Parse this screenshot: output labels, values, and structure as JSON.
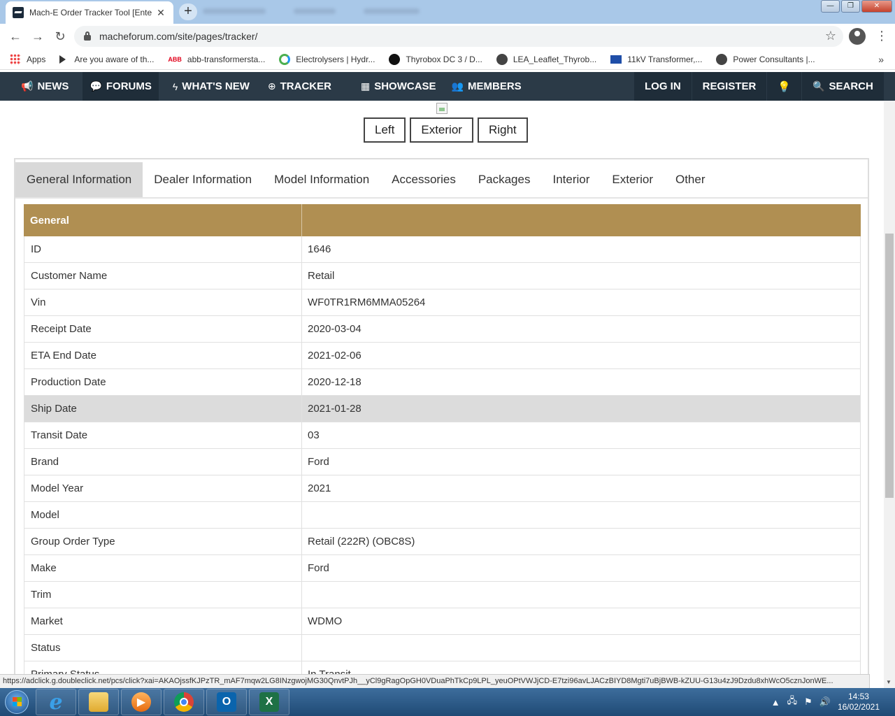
{
  "browser": {
    "tab_title": "Mach-E Order Tracker Tool [Ente",
    "tab_close": "✕",
    "new_tab": "+",
    "back": "←",
    "forward": "→",
    "reload": "↻",
    "url": "macheforum.com/site/pages/tracker/",
    "star": "☆",
    "menu": "⋮",
    "bookmarks_more": "»",
    "window_controls": {
      "minimize": "—",
      "restore": "❐",
      "close": "✕"
    },
    "bookmarks": [
      {
        "label": "Apps",
        "icon": "apps-grid-icon"
      },
      {
        "label": "Are you aware of th...",
        "icon": "play-icon"
      },
      {
        "label": "abb-transformersta...",
        "icon": "abb-logo-icon",
        "logo_text": "ABB"
      },
      {
        "label": "Electrolysers | Hydr...",
        "icon": "electrolysers-icon"
      },
      {
        "label": "Thyrobox DC 3 / D...",
        "icon": "thyrobox-icon"
      },
      {
        "label": "LEA_Leaflet_Thyrob...",
        "icon": "globe-icon"
      },
      {
        "label": "11kV Transformer,...",
        "icon": "sc-logo-icon"
      },
      {
        "label": "Power Consultants |...",
        "icon": "globe-icon"
      }
    ]
  },
  "site_nav": {
    "items": [
      {
        "label": "NEWS",
        "icon": "megaphone-icon",
        "glyph": "📢"
      },
      {
        "label": "FORUMS",
        "icon": "chat-icon",
        "glyph": "💬"
      },
      {
        "label": "WHAT'S NEW",
        "icon": "lightning-icon",
        "glyph": "ϟ"
      },
      {
        "label": "TRACKER",
        "icon": "globe-icon",
        "glyph": "⊕"
      },
      {
        "label": "SHOWCASE",
        "icon": "table-icon",
        "glyph": "▦"
      },
      {
        "label": "MEMBERS",
        "icon": "members-icon",
        "glyph": "👥"
      }
    ],
    "login": "LOG IN",
    "register": "REGISTER",
    "bulb_glyph": "💡",
    "search": "SEARCH",
    "search_glyph": "🔍"
  },
  "view_buttons": [
    "Left",
    "Exterior",
    "Right"
  ],
  "tabs": [
    {
      "label": "General Information",
      "active": true
    },
    {
      "label": "Dealer Information"
    },
    {
      "label": "Model Information"
    },
    {
      "label": "Accessories"
    },
    {
      "label": "Packages"
    },
    {
      "label": "Interior"
    },
    {
      "label": "Exterior"
    },
    {
      "label": "Other"
    }
  ],
  "table": {
    "header": "General",
    "rows": [
      {
        "label": "ID",
        "value": "1646"
      },
      {
        "label": "Customer Name",
        "value": "Retail"
      },
      {
        "label": "Vin",
        "value": "WF0TR1RM6MMA05264"
      },
      {
        "label": "Receipt Date",
        "value": "2020-03-04"
      },
      {
        "label": "ETA End Date",
        "value": "2021-02-06"
      },
      {
        "label": "Production Date",
        "value": "2020-12-18"
      },
      {
        "label": "Ship Date",
        "value": "2021-01-28",
        "highlight": true
      },
      {
        "label": "Transit Date",
        "value": "03"
      },
      {
        "label": "Brand",
        "value": "Ford"
      },
      {
        "label": "Model Year",
        "value": "2021"
      },
      {
        "label": "Model",
        "value": ""
      },
      {
        "label": "Group Order Type",
        "value": "Retail (222R) (OBC8S)"
      },
      {
        "label": "Make",
        "value": "Ford"
      },
      {
        "label": "Trim",
        "value": ""
      },
      {
        "label": "Market",
        "value": "WDMO"
      },
      {
        "label": "Status",
        "value": ""
      },
      {
        "label": "Primary Status",
        "value": "In Transit"
      }
    ]
  },
  "status_url": "https://adclick.g.doubleclick.net/pcs/click?xai=AKAOjssfKJPzTR_mAF7mqw2LG8INzgwojMG30QnvtPJh__yCl9gRagOpGH0VDuaPhTkCp9LPL_yeuOPtVWJjCD-E7tzi96avLJACzBIYD8Mgti7uBjBWB-kZUU-G13u4zJ9Dzdu8xhWcO5cznJonWE...",
  "taskbar": {
    "apps": [
      {
        "name": "ie",
        "glyph": "e"
      },
      {
        "name": "explorer",
        "glyph": ""
      },
      {
        "name": "media",
        "glyph": "▶"
      },
      {
        "name": "chrome",
        "glyph": ""
      },
      {
        "name": "outlook",
        "glyph": "O"
      },
      {
        "name": "excel",
        "glyph": "X"
      }
    ],
    "tray_glyphs": {
      "arrow": "▲",
      "network": "🖧",
      "flag": "⚑",
      "volume": "🔊"
    },
    "time": "14:53",
    "date": "16/02/2021"
  },
  "colors": {
    "nav_bg": "#2b3a47",
    "table_header": "#b08f52",
    "active_tab": "#d9d9d9",
    "highlight_row": "#dcdcdc"
  }
}
